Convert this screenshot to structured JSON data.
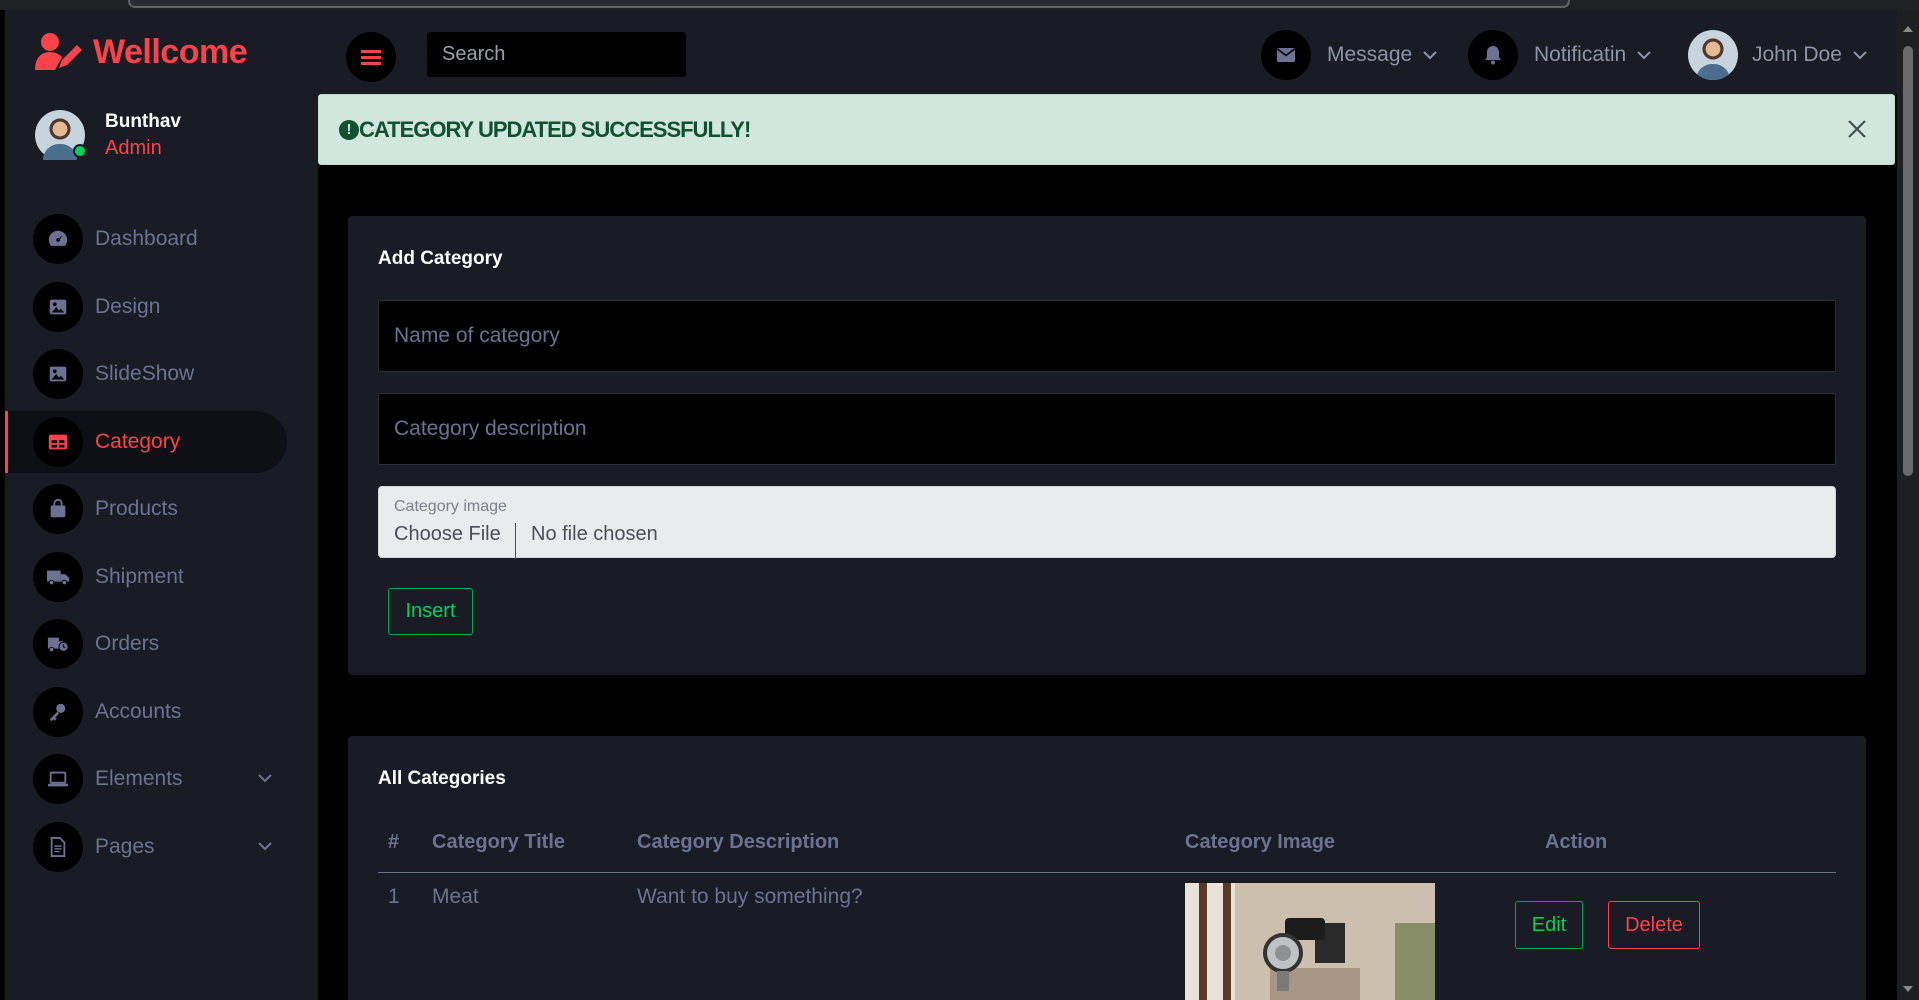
{
  "brand": {
    "name": "Wellcome"
  },
  "profile": {
    "name": "Bunthav",
    "role": "Admin"
  },
  "sidebar": {
    "items": [
      {
        "label": "Dashboard",
        "icon": "speedometer-icon"
      },
      {
        "label": "Design",
        "icon": "image-icon"
      },
      {
        "label": "SlideShow",
        "icon": "image-icon"
      },
      {
        "label": "Category",
        "icon": "table-icon",
        "active": true
      },
      {
        "label": "Products",
        "icon": "shopping-bag-icon"
      },
      {
        "label": "Shipment",
        "icon": "truck-icon"
      },
      {
        "label": "Orders",
        "icon": "truck-clock-icon"
      },
      {
        "label": "Accounts",
        "icon": "key-icon"
      },
      {
        "label": "Elements",
        "icon": "laptop-icon",
        "has_submenu": true
      },
      {
        "label": "Pages",
        "icon": "file-icon",
        "has_submenu": true
      }
    ]
  },
  "topbar": {
    "search_placeholder": "Search",
    "message_label": "Message",
    "notification_label": "Notificatin",
    "user_name": "John Doe"
  },
  "alert": {
    "text": "CATEGORY UPDATED SUCCESSFULLY!"
  },
  "add_category": {
    "title": "Add Category",
    "name_placeholder": "Name of category",
    "description_placeholder": "Category description",
    "image_label": "Category image",
    "choose_file_label": "Choose File",
    "file_status": "No file chosen",
    "insert_label": "Insert"
  },
  "all_categories": {
    "title": "All Categories",
    "columns": [
      "#",
      "Category Title",
      "Category Description",
      "Category Image",
      "Action"
    ],
    "rows": [
      {
        "index": "1",
        "title": "Meat",
        "description": "Want to buy something?",
        "edit_label": "Edit",
        "delete_label": "Delete"
      }
    ]
  },
  "colors": {
    "accent": "#fc424a",
    "success": "#00d25b",
    "sidebar_bg": "#191c24",
    "alert_bg": "#d1e7dd",
    "alert_text": "#0f5132",
    "muted_text": "#6c7293"
  }
}
